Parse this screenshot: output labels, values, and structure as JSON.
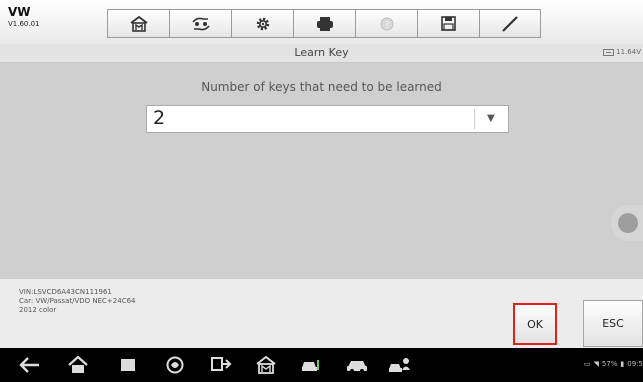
{
  "app": {
    "brand": "VW",
    "version": "V1.60.01"
  },
  "toolbar": {
    "buttons": [
      {
        "name": "home-icon"
      },
      {
        "name": "vehicle-swap-icon"
      },
      {
        "name": "settings-gear-icon"
      },
      {
        "name": "print-icon"
      },
      {
        "name": "help-icon"
      },
      {
        "name": "save-icon"
      },
      {
        "name": "edit-pen-icon"
      }
    ]
  },
  "page": {
    "title": "Learn Key",
    "battery_voltage": "11.64V"
  },
  "main": {
    "prompt": "Number of keys that need to be learned",
    "select": {
      "value": "2"
    }
  },
  "vehicle": {
    "vin": "VIN:LSVCD6A43CN111961",
    "car": "Car: VW/Passat/VDO NEC+24C64",
    "year": "2012 color"
  },
  "actions": {
    "ok_label": "OK",
    "esc_label": "ESC"
  },
  "status": {
    "battery": "57%",
    "time": "09:5"
  },
  "colors": {
    "highlight": "#e0201a",
    "content_bg": "#cfcfcf"
  }
}
